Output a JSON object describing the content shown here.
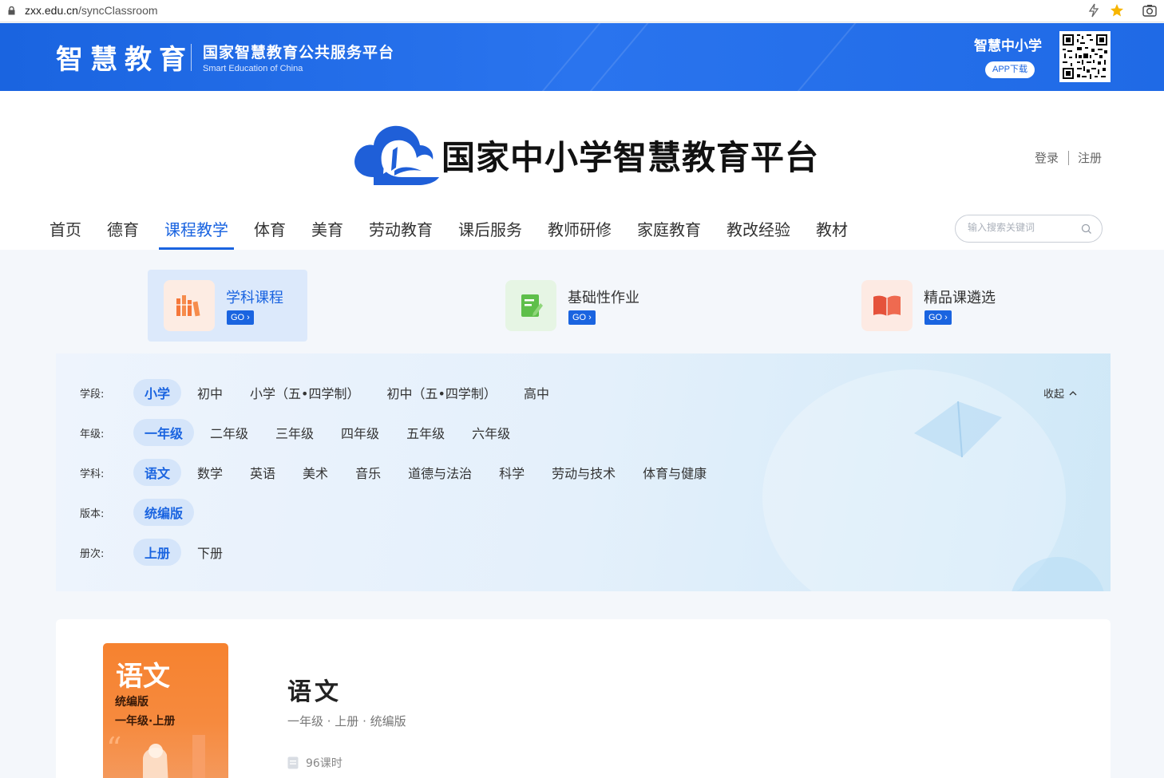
{
  "browser": {
    "url_domain": "zxx.edu.cn",
    "url_path": "/syncClassroom"
  },
  "banner": {
    "logo_text": "智慧教育",
    "platform_cn": "国家智慧教育公共服务平台",
    "platform_en": "Smart Education of China",
    "app_title": "智慧中小学",
    "app_button": "APP下载"
  },
  "header": {
    "site_title": "国家中小学智慧教育平台",
    "login": "登录",
    "register": "注册"
  },
  "nav": {
    "items": [
      "首页",
      "德育",
      "课程教学",
      "体育",
      "美育",
      "劳动教育",
      "课后服务",
      "教师研修",
      "家庭教育",
      "教改经验",
      "教材"
    ],
    "active": "课程教学",
    "search_placeholder": "输入搜索关键词"
  },
  "features": [
    {
      "title": "学科课程",
      "go": "GO",
      "active": true,
      "icon": "books-icon",
      "bg": "#fdece3"
    },
    {
      "title": "基础性作业",
      "go": "GO",
      "active": false,
      "icon": "homework-icon",
      "bg": "#e6f5e4"
    },
    {
      "title": "精品课遴选",
      "go": "GO",
      "active": false,
      "icon": "open-book-icon",
      "bg": "#fdeae3"
    }
  ],
  "filters": {
    "collapse_label": "收起",
    "rows": [
      {
        "label": "学段:",
        "options": [
          "小学",
          "初中",
          "小学（五•四学制）",
          "初中（五•四学制）",
          "高中"
        ],
        "selected": "小学"
      },
      {
        "label": "年级:",
        "options": [
          "一年级",
          "二年级",
          "三年级",
          "四年级",
          "五年级",
          "六年级"
        ],
        "selected": "一年级"
      },
      {
        "label": "学科:",
        "options": [
          "语文",
          "数学",
          "英语",
          "美术",
          "音乐",
          "道德与法治",
          "科学",
          "劳动与技术",
          "体育与健康"
        ],
        "selected": "语文"
      },
      {
        "label": "版本:",
        "options": [
          "统编版"
        ],
        "selected": "统编版"
      },
      {
        "label": "册次:",
        "options": [
          "上册",
          "下册"
        ],
        "selected": "上册"
      }
    ]
  },
  "course": {
    "cover_title": "语文",
    "cover_edition": "统编版",
    "cover_grade": "一年级·上册",
    "title": "语文",
    "meta": "一年级 · 上册 · 统编版",
    "hours": "96课时"
  },
  "colors": {
    "brand_blue": "#1a64e0",
    "cover_orange": "#f6822f"
  }
}
